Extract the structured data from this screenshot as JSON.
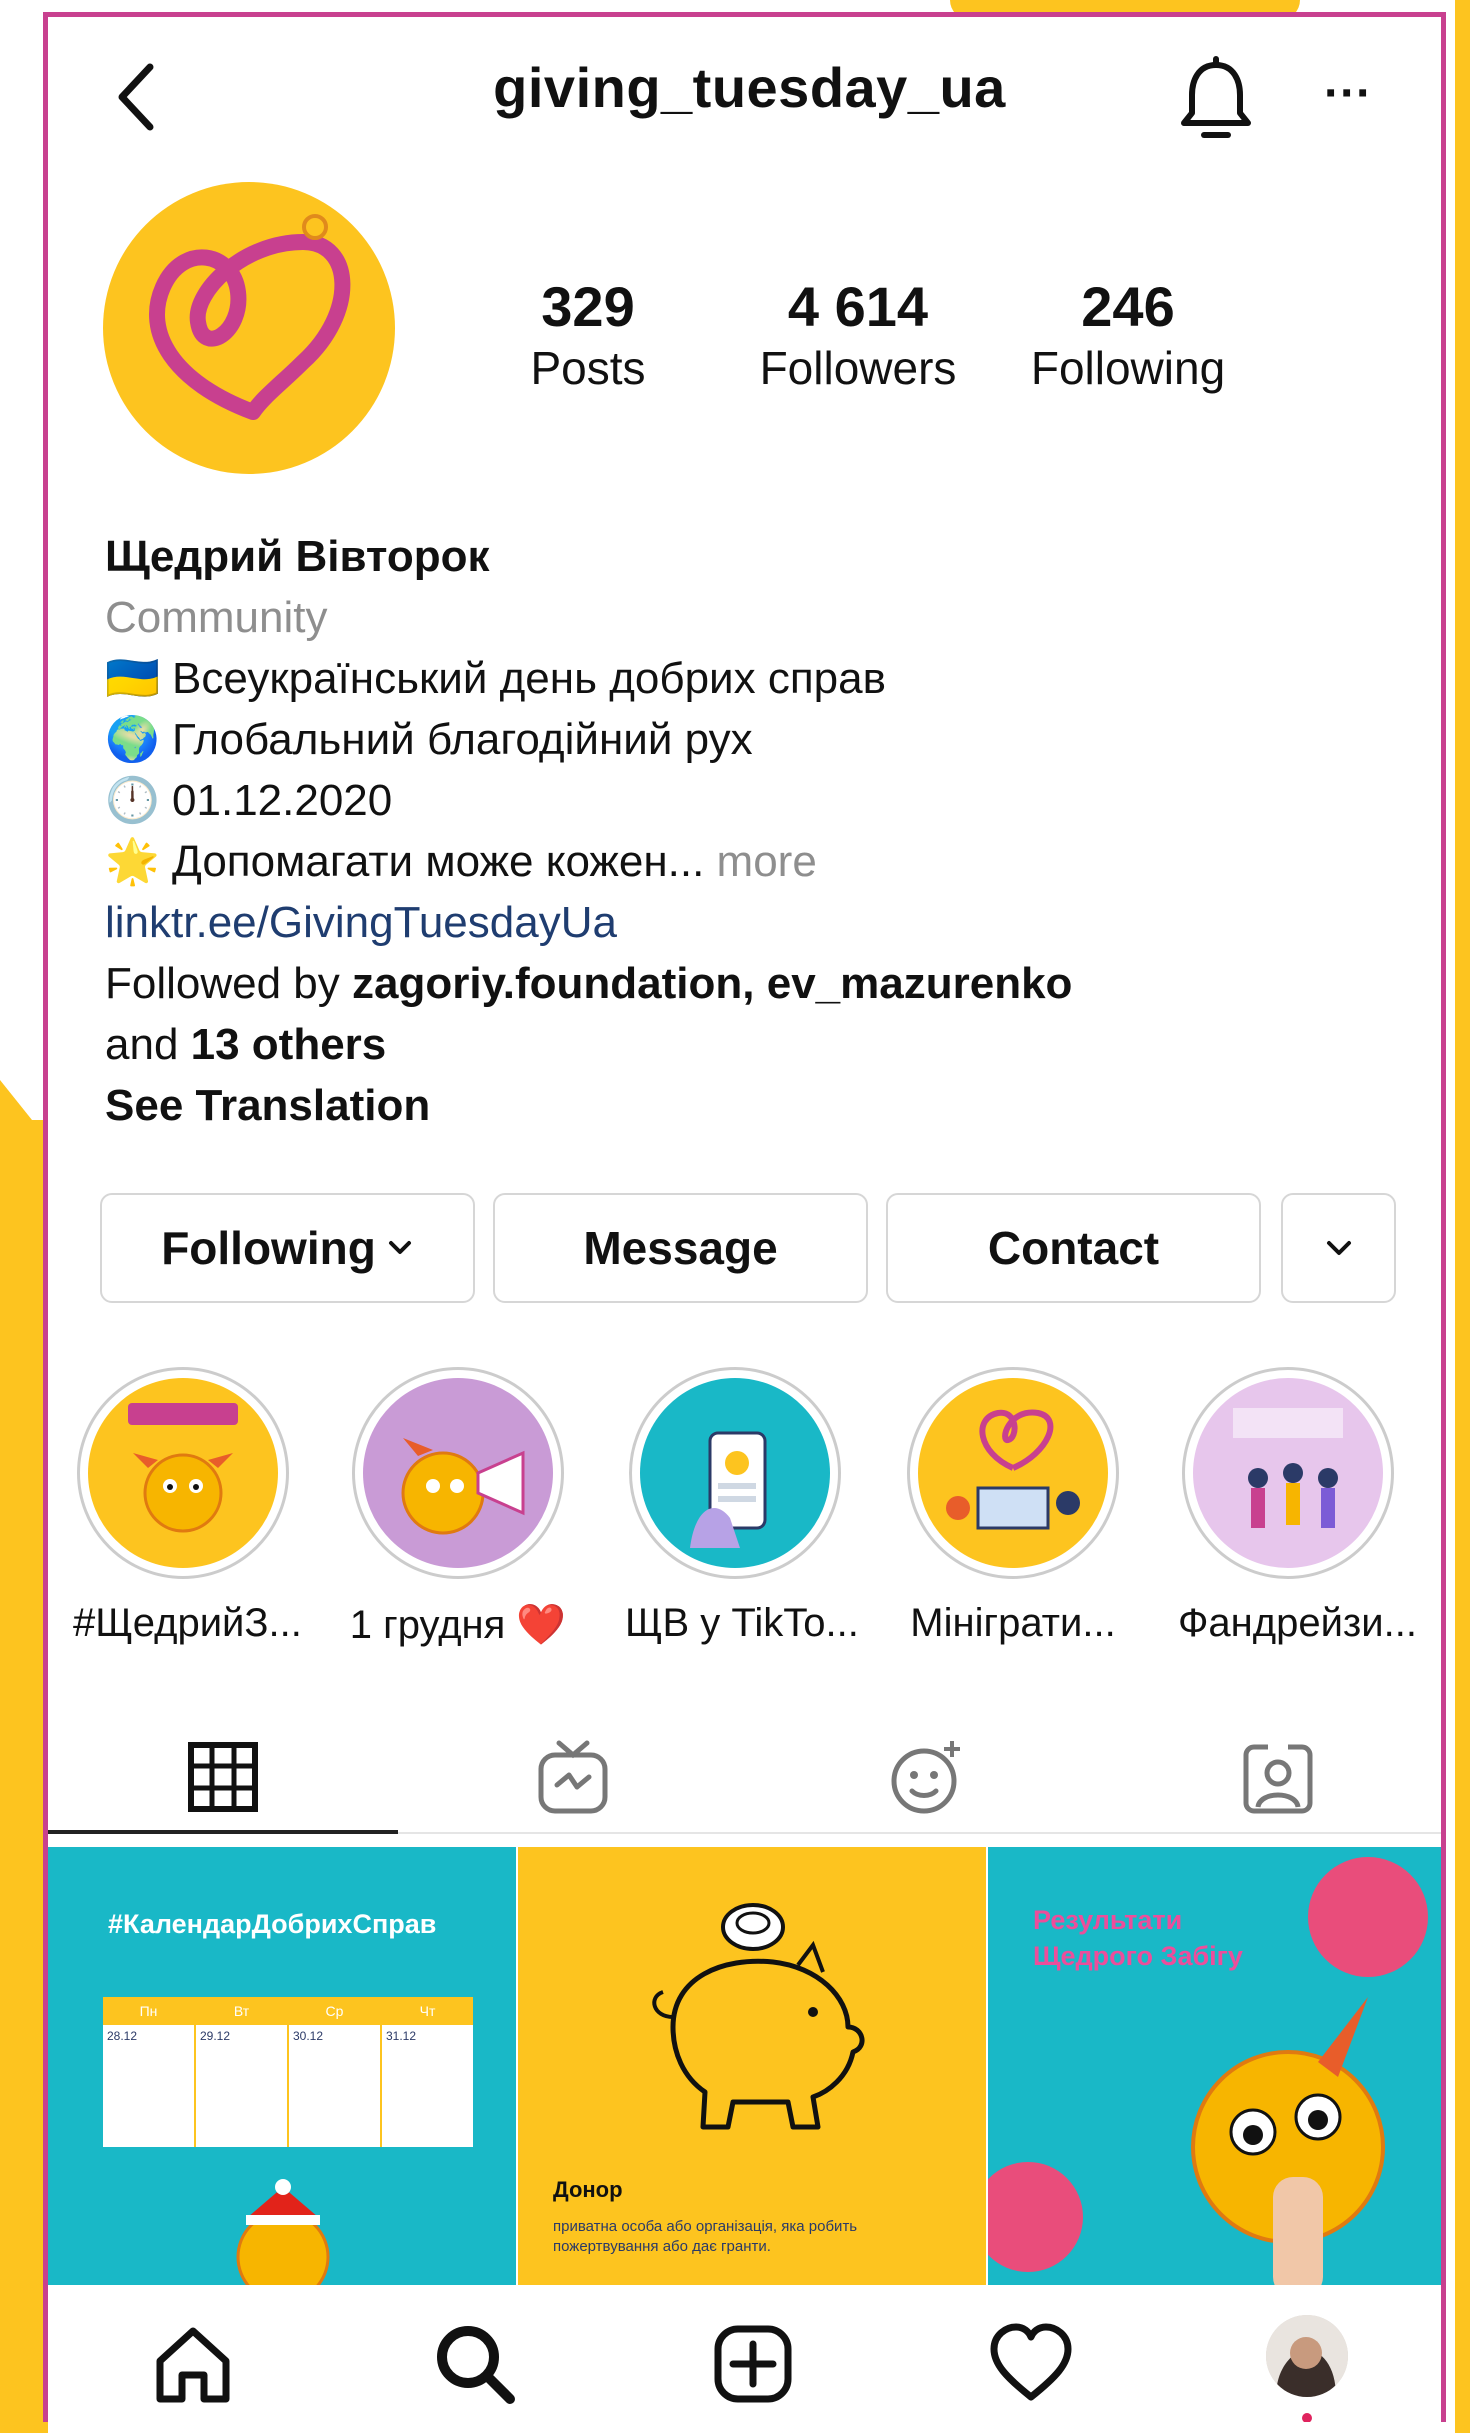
{
  "header": {
    "username": "giving_tuesday_ua"
  },
  "stats": [
    {
      "num": "329",
      "label": "Posts"
    },
    {
      "num": "4 614",
      "label": "Followers"
    },
    {
      "num": "246",
      "label": "Following"
    }
  ],
  "bio": {
    "name": "Щедрий Вівторок",
    "category": "Community",
    "lines": [
      {
        "emoji": "🇺🇦",
        "text": "Всеукраїнський день добрих справ"
      },
      {
        "emoji": "🌍",
        "text": "Глобальний благодійний рух"
      },
      {
        "emoji": "🕛",
        "text": "01.12.2020"
      },
      {
        "emoji": "🌟",
        "text": "Допомагати може кожен..."
      }
    ],
    "more": "more",
    "link": "linktr.ee/GivingTuesdayUa",
    "followed_prefix": "Followed by ",
    "followed_users": "zagoriy.foundation, ev_mazurenko",
    "followed_and": "and ",
    "followed_others": "13 others",
    "see_translation": "See Translation"
  },
  "buttons": {
    "following": "Following",
    "message": "Message",
    "contact": "Contact"
  },
  "highlights": [
    {
      "label": "#ЩедрийЗ..."
    },
    {
      "label": "1 грудня ❤️"
    },
    {
      "label": "ЩВ у TikTo..."
    },
    {
      "label": "Мініграти..."
    },
    {
      "label": "Фандрейзи..."
    }
  ],
  "posts": [
    {
      "title": "#КалендарДобрихСправ",
      "days": [
        "Пн",
        "Вт",
        "Ср",
        "Чт"
      ],
      "dates": [
        "28.12",
        "29.12",
        "30.12",
        "31.12"
      ]
    },
    {
      "title": "Донор",
      "caption": "приватна особа або організація, яка робить пожертвування або дає гранти."
    },
    {
      "title": "Результати Щедрого Забігу"
    }
  ],
  "colors": {
    "accent": "#c8408f",
    "yellow": "#fdc41f",
    "teal": "#19b8c7",
    "link": "#1f3d70"
  }
}
